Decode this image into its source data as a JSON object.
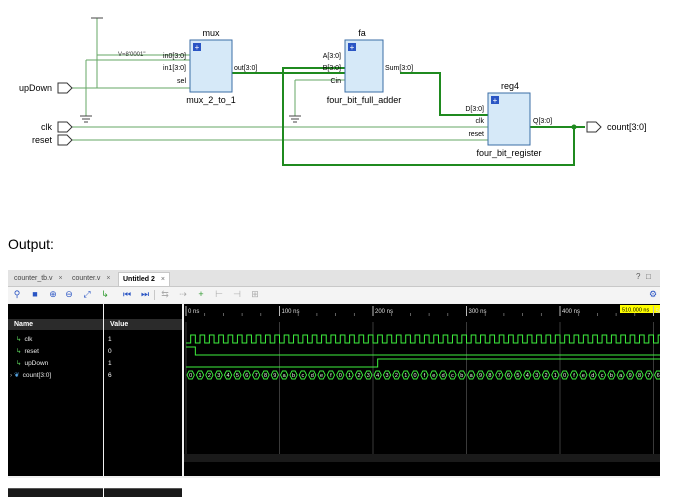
{
  "schematic": {
    "const_label": "V=8'0001\"",
    "ports": {
      "updown": "upDown",
      "clk": "clk",
      "reset": "reset",
      "count": "count[3:0]"
    },
    "mux": {
      "name": "mux",
      "type": "mux_2_to_1",
      "pins": {
        "in0": "in0[3:0]",
        "in1": "in1[3:0]",
        "sel": "sel",
        "out": "out[3:0]"
      }
    },
    "fa": {
      "name": "fa",
      "type": "four_bit_full_adder",
      "pins": {
        "a": "A[3:0]",
        "b": "B[3:0]",
        "cin": "Cin",
        "sum": "Sum[3:0]"
      }
    },
    "reg": {
      "name": "reg4",
      "type": "four_bit_register",
      "pins": {
        "d": "D[3:0]",
        "clk": "clk",
        "reset": "reset",
        "q": "Q[3:0]"
      }
    },
    "colors": {
      "wire": "#66a766",
      "bus": "#1f8a1f",
      "block_fill": "#d6e9f8",
      "block_border": "#3b6ea6",
      "icon": "#2a55c4"
    }
  },
  "output_label": "Output:",
  "sim": {
    "tabs": [
      {
        "label": "counter_tb.v",
        "close": "×"
      },
      {
        "label": "counter.v",
        "close": "×"
      },
      {
        "label": "Untitled 2",
        "close": "×"
      }
    ],
    "window_controls": [
      "?",
      "□"
    ],
    "toolbar_icons": [
      "search-icon",
      "save-icon",
      "zoom-in-icon",
      "zoom-out-icon",
      "zoom-fit-icon",
      "fit-all-icon",
      "go-to-cursor-icon",
      "prev-transition-icon",
      "next-transition-icon",
      "add-marker-icon",
      "prev-marker-icon",
      "next-marker-icon",
      "swap-cursors-icon",
      "snap-icon",
      "insert-marker-icon",
      "marker-list-icon"
    ],
    "headers": {
      "name": "Name",
      "value": "Value"
    },
    "cursor_time": "510.000 ns",
    "time_labels": [
      "0 ns",
      "100 ns",
      "200 ns",
      "300 ns",
      "400 ns",
      "50"
    ],
    "signals": [
      {
        "name": "clk",
        "value": "1",
        "kind": "bit"
      },
      {
        "name": "reset",
        "value": "0",
        "kind": "bit"
      },
      {
        "name": "upDown",
        "value": "1",
        "kind": "bit"
      },
      {
        "name": "count[3:0]",
        "value": "6",
        "kind": "bus"
      }
    ],
    "count_sequence": [
      "0",
      "1",
      "2",
      "3",
      "4",
      "5",
      "6",
      "7",
      "8",
      "9",
      "a",
      "b",
      "c",
      "d",
      "e",
      "f",
      "0",
      "1",
      "2",
      "3",
      "4",
      "3",
      "2",
      "1",
      "0",
      "f",
      "e",
      "d",
      "c",
      "b",
      "a",
      "9",
      "8",
      "7",
      "6",
      "5",
      "4",
      "3",
      "2",
      "1",
      "0",
      "f",
      "e",
      "d",
      "c",
      "b",
      "a",
      "9",
      "8",
      "7",
      "6"
    ],
    "colors": {
      "wave": "#3ef03e",
      "cursor_tag": "#ffff00",
      "grid": "#3a3a3a"
    }
  }
}
